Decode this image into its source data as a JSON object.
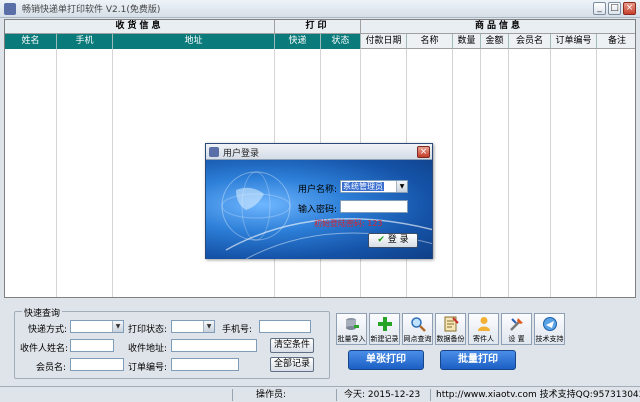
{
  "window": {
    "title": "畅销快递单打印软件 V2.1(免费版)",
    "buttons": [
      "_",
      "□",
      "×"
    ]
  },
  "grid": {
    "groups": [
      "收货信息",
      "打印",
      "商品信息"
    ],
    "columns": [
      "姓名",
      "手机",
      "地址",
      "快递",
      "状态",
      "付款日期",
      "名称",
      "数量",
      "金额",
      "会员名",
      "订单编号",
      "备注"
    ]
  },
  "query": {
    "legend": "快速查询",
    "express_label": "快递方式:",
    "print_status_label": "打印状态:",
    "phone_label": "手机号:",
    "receiver_name_label": "收件人姓名:",
    "receiver_addr_label": "收件地址:",
    "clear_btn": "清空条件",
    "member_label": "会员名:",
    "order_label": "订单编号:",
    "all_btn": "全部记录"
  },
  "toolbar": [
    {
      "label": "批量导入",
      "icon": "database-import-icon"
    },
    {
      "label": "新建记录",
      "icon": "plus-icon"
    },
    {
      "label": "网点查询",
      "icon": "magnifier-icon"
    },
    {
      "label": "数据备份",
      "icon": "backup-icon"
    },
    {
      "label": "寄件人",
      "icon": "user-icon"
    },
    {
      "label": "设 置",
      "icon": "settings-icon"
    },
    {
      "label": "技术支持",
      "icon": "support-icon"
    }
  ],
  "print_single": "单张打印",
  "print_batch": "批量打印",
  "status": {
    "operator": "操作员:",
    "today": "今天: 2015-12-23",
    "site": "http://www.xiaotv.com 技术支持QQ:957313043"
  },
  "login": {
    "title": "用户登录",
    "username_label": "用户名称:",
    "username_value": "系统管理员",
    "password_label": "输入密码:",
    "hint": "初始登陆密码: 123",
    "login_btn": "登 录"
  }
}
